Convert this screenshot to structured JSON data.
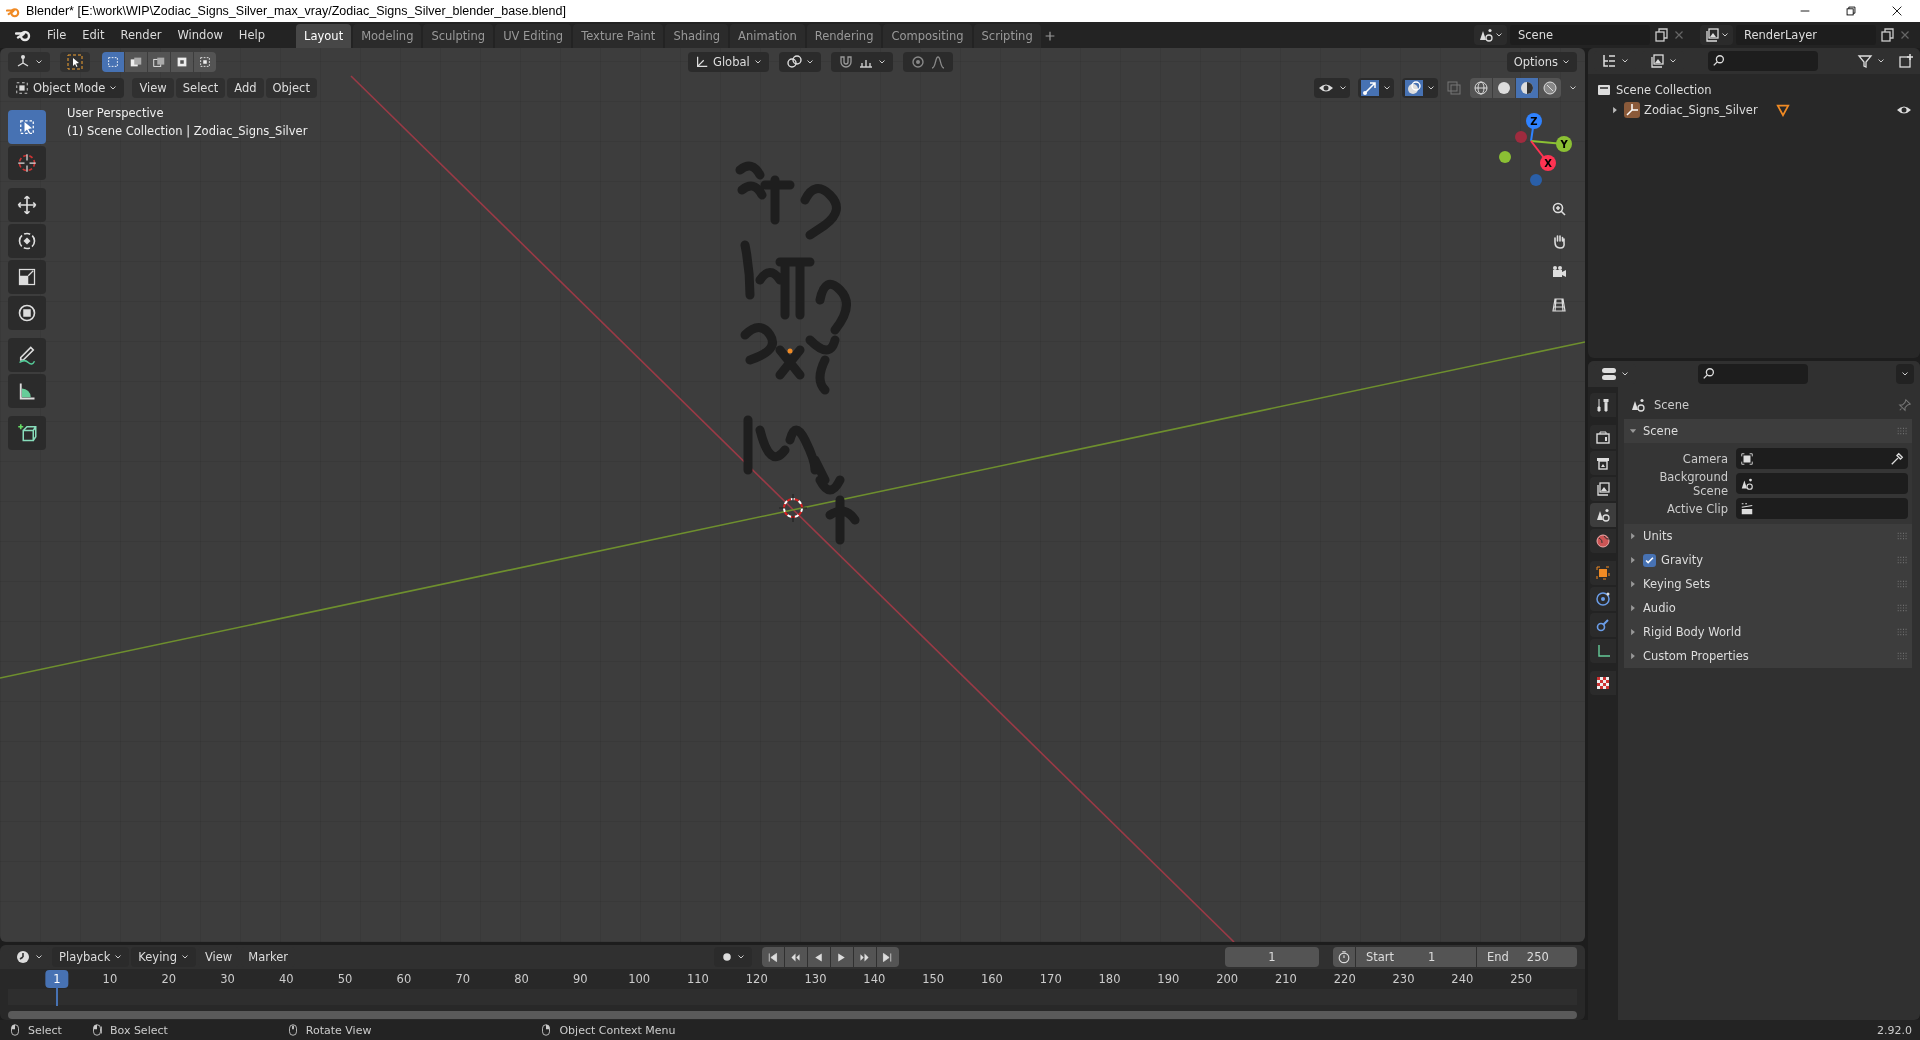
{
  "window": {
    "title": "Blender* [E:\\work\\WIP\\Zodiac_Signs_Silver_max_vray/Zodiac_Signs_Silver_blender_base.blend]"
  },
  "menu": [
    "File",
    "Edit",
    "Render",
    "Window",
    "Help"
  ],
  "workspaces": [
    {
      "label": "Layout",
      "selected": true
    },
    {
      "label": "Modeling",
      "selected": false
    },
    {
      "label": "Sculpting",
      "selected": false
    },
    {
      "label": "UV Editing",
      "selected": false
    },
    {
      "label": "Texture Paint",
      "selected": false
    },
    {
      "label": "Shading",
      "selected": false
    },
    {
      "label": "Animation",
      "selected": false
    },
    {
      "label": "Rendering",
      "selected": false
    },
    {
      "label": "Compositing",
      "selected": false
    },
    {
      "label": "Scripting",
      "selected": false
    }
  ],
  "scene_selector": {
    "value": "Scene"
  },
  "view_layer_selector": {
    "value": "RenderLayer"
  },
  "viewport": {
    "select_modes": [
      {
        "selected": true
      },
      {
        "selected": false
      },
      {
        "selected": false
      },
      {
        "selected": false
      },
      {
        "selected": false
      }
    ],
    "transform_orientation": "Global",
    "options": "Options",
    "gizmos_on": true,
    "overlays_on": true,
    "mode": "Object Mode",
    "menus": [
      "View",
      "Select",
      "Add",
      "Object"
    ],
    "shading_modes": [
      {
        "kind": "wireframe",
        "selected": false
      },
      {
        "kind": "solid",
        "selected": false
      },
      {
        "kind": "material",
        "selected": true
      },
      {
        "kind": "rendered",
        "selected": false
      }
    ],
    "info": [
      "User Perspective",
      "(1) Scene Collection | Zodiac_Signs_Silver"
    ],
    "tools": [
      {
        "kind": "select",
        "selected": true
      },
      {
        "kind": "cursor",
        "selected": false
      },
      {
        "kind": "move",
        "selected": false
      },
      {
        "kind": "rotate",
        "selected": false
      },
      {
        "kind": "scale",
        "selected": false
      },
      {
        "kind": "transform",
        "selected": false
      },
      {
        "kind": "annotate",
        "selected": false
      },
      {
        "kind": "measure",
        "selected": false
      },
      {
        "kind": "add_cube",
        "selected": false
      }
    ],
    "gizmo_axes": [
      "Z",
      "Y",
      "X"
    ]
  },
  "outliner": {
    "root": "Scene Collection",
    "items": [
      {
        "label": "Zodiac_Signs_Silver",
        "expanded": false,
        "visible": true
      }
    ]
  },
  "properties": {
    "tabs": [
      {
        "kind": "tool",
        "selected": false
      },
      {
        "kind": "render",
        "selected": false
      },
      {
        "kind": "output",
        "selected": false
      },
      {
        "kind": "view_layer",
        "selected": false
      },
      {
        "kind": "scene",
        "selected": true
      },
      {
        "kind": "world",
        "selected": false
      },
      {
        "kind": "object",
        "selected": false
      },
      {
        "kind": "physics",
        "selected": false
      },
      {
        "kind": "constraints",
        "selected": false
      },
      {
        "kind": "data",
        "selected": false
      },
      {
        "kind": "texture",
        "selected": false
      }
    ],
    "context": "Scene",
    "panels": [
      {
        "title": "Scene",
        "expanded": true,
        "fields": [
          {
            "label": "Camera",
            "kind": "camera"
          },
          {
            "label": "Background Scene",
            "kind": "scene"
          },
          {
            "label": "Active Clip",
            "kind": "clip"
          }
        ]
      },
      {
        "title": "Units",
        "expanded": false
      },
      {
        "title": "Gravity",
        "expanded": false,
        "checked": true
      },
      {
        "title": "Keying Sets",
        "expanded": false
      },
      {
        "title": "Audio",
        "expanded": false
      },
      {
        "title": "Rigid Body World",
        "expanded": false
      },
      {
        "title": "Custom Properties",
        "expanded": false
      }
    ]
  },
  "timeline": {
    "menus": [
      "Playback",
      "Keying",
      "View",
      "Marker"
    ],
    "current_frame": "1",
    "start_label": "Start",
    "start": "1",
    "end_label": "End",
    "end": "250",
    "ruler": [
      {
        "label": "1",
        "current": true
      },
      {
        "label": "10",
        "current": false
      },
      {
        "label": "20",
        "current": false
      },
      {
        "label": "30",
        "current": false
      },
      {
        "label": "40",
        "current": false
      },
      {
        "label": "50",
        "current": false
      },
      {
        "label": "60",
        "current": false
      },
      {
        "label": "70",
        "current": false
      },
      {
        "label": "80",
        "current": false
      },
      {
        "label": "90",
        "current": false
      },
      {
        "label": "100",
        "current": false
      },
      {
        "label": "110",
        "current": false
      },
      {
        "label": "120",
        "current": false
      },
      {
        "label": "130",
        "current": false
      },
      {
        "label": "140",
        "current": false
      },
      {
        "label": "150",
        "current": false
      },
      {
        "label": "160",
        "current": false
      },
      {
        "label": "170",
        "current": false
      },
      {
        "label": "180",
        "current": false
      },
      {
        "label": "190",
        "current": false
      },
      {
        "label": "200",
        "current": false
      },
      {
        "label": "210",
        "current": false
      },
      {
        "label": "220",
        "current": false
      },
      {
        "label": "230",
        "current": false
      },
      {
        "label": "240",
        "current": false
      },
      {
        "label": "250",
        "current": false
      }
    ]
  },
  "status_bar": {
    "hints": [
      {
        "kind": "left",
        "label": "Select"
      },
      {
        "kind": "drag",
        "label": "Box Select"
      },
      {
        "kind": "middle",
        "label": "Rotate View"
      },
      {
        "kind": "right",
        "label": "Object Context Menu"
      }
    ],
    "version": "2.92.0"
  }
}
